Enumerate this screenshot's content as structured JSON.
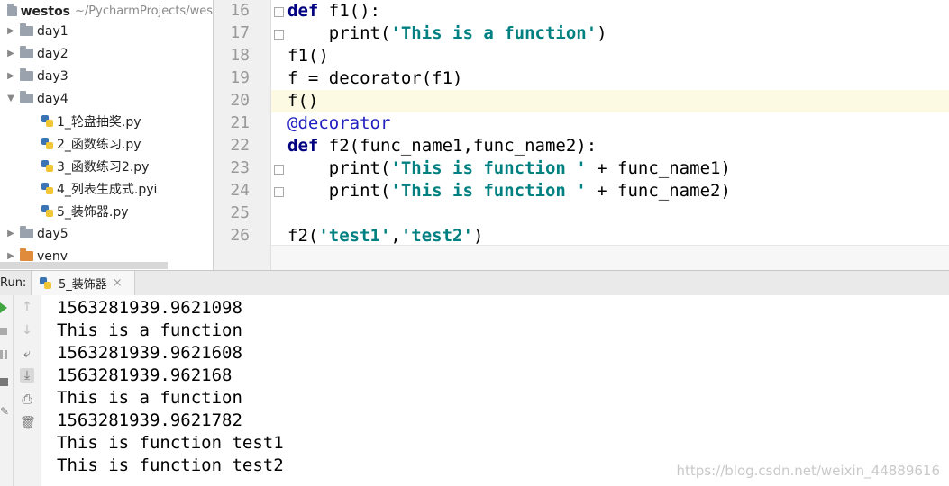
{
  "project": {
    "root_name": "westos",
    "root_path": "~/PycharmProjects/wes",
    "items": [
      {
        "label": "day1",
        "type": "folder",
        "expanded": false
      },
      {
        "label": "day2",
        "type": "folder",
        "expanded": false
      },
      {
        "label": "day3",
        "type": "folder",
        "expanded": false
      },
      {
        "label": "day4",
        "type": "folder",
        "expanded": true
      },
      {
        "label": "1_轮盘抽奖.py",
        "type": "python-file"
      },
      {
        "label": "2_函数练习.py",
        "type": "python-file"
      },
      {
        "label": "3_函数练习2.py",
        "type": "python-file"
      },
      {
        "label": "4_列表生成式.pyi",
        "type": "python-file"
      },
      {
        "label": "5_装饰器.py",
        "type": "python-file"
      },
      {
        "label": "day5",
        "type": "folder",
        "expanded": false
      },
      {
        "label": "venv",
        "type": "folder-excluded",
        "expanded": false
      }
    ]
  },
  "editor": {
    "current_line": 20,
    "lines": [
      {
        "num": "16",
        "text": "def f1():"
      },
      {
        "num": "17",
        "text": "    print('This is a function')"
      },
      {
        "num": "18",
        "text": "f1()"
      },
      {
        "num": "19",
        "text": "f = decorator(f1)"
      },
      {
        "num": "20",
        "text": "f()"
      },
      {
        "num": "21",
        "text": "@decorator"
      },
      {
        "num": "22",
        "text": "def f2(func_name1,func_name2):"
      },
      {
        "num": "23",
        "text": "    print('This is function ' + func_name1)"
      },
      {
        "num": "24",
        "text": "    print('This is function ' + func_name2)"
      },
      {
        "num": "25",
        "text": ""
      },
      {
        "num": "26",
        "text": "f2('test1','test2')"
      }
    ]
  },
  "run": {
    "label": "Run:",
    "tab_label": "5_装饰器",
    "tab_close": "×",
    "output": [
      "1563281939.9621098",
      "This is a function",
      "1563281939.9621608",
      "1563281939.962168",
      "This is a function",
      "1563281939.9621782",
      "This is function test1",
      "This is function test2"
    ]
  },
  "watermark": "https://blog.csdn.net/weixin_44889616",
  "colors": {
    "keyword": "#000080",
    "string": "#008080",
    "decorator": "#2020c0",
    "current_line": "#fcfae2"
  }
}
